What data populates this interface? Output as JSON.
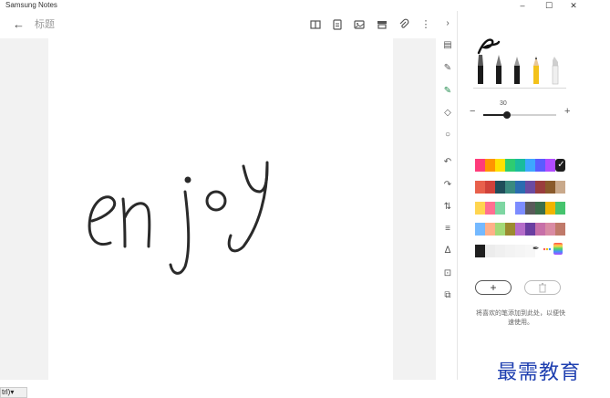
{
  "window": {
    "title": "Samsung Notes",
    "controls": [
      "minimize",
      "maximize",
      "close"
    ]
  },
  "toolbar": {
    "back_icon": "back-arrow-icon",
    "note_title": "标题",
    "icons": [
      "book-view-icon",
      "page-template-icon",
      "image-icon",
      "stamp-icon",
      "attach-icon",
      "more-icon"
    ]
  },
  "canvas": {
    "handwriting": "enjoy"
  },
  "side_tools": [
    "collapse-chevron-icon",
    "text-mode-icon",
    "pen-icon",
    "highlighter-icon",
    "eraser-icon",
    "lasso-icon",
    "undo-icon",
    "redo-icon",
    "spacing-icon",
    "format-icon",
    "ai-icon",
    "insert-icon",
    "layers-icon"
  ],
  "pen_panel": {
    "pens": [
      "brush-pen",
      "fountain-pen",
      "calligraphy-pen",
      "pencil",
      "marker"
    ],
    "size": {
      "label": "30",
      "min_icon": "−",
      "max_icon": "+",
      "value_fraction": 0.32
    },
    "palette": [
      [
        "#ff3b7a",
        "#ff9500",
        "#ffe100",
        "#2ecc71",
        "#1abc9c",
        "#3ea6ff",
        "#5a5cff",
        "#b14cff",
        "#1d1d1d"
      ],
      [
        "#e8604c",
        "#d0423a",
        "#1f4e5a",
        "#3a8a7f",
        "#2b6cb0",
        "#6b4ba1",
        "#9a3d3d",
        "#8a5a2b",
        "#c9a98b"
      ],
      [
        "#ffd54f",
        "#ff6f91",
        "#7ed6a2",
        "#ffffff",
        "#7c8cff",
        "#5a5a5a",
        "#3c6e4a",
        "#f0b400",
        "#46c46e"
      ],
      [
        "#74b9ff",
        "#ffb088",
        "#a3d977",
        "#9c8b2f",
        "#b56cc9",
        "#6a3ea1",
        "#c76fa8",
        "#d98ba4",
        "#c07a6a"
      ],
      [
        "#1f1f1f",
        "#ececec",
        "#f0f0f0",
        "#f3f3f3",
        "#f5f5f5",
        "#f7f7f7"
      ]
    ],
    "selected_color": "#1d1d1d",
    "check_mark": "✓",
    "eyedropper_icon": "eyedropper-icon",
    "palette_icon": "palette-icon",
    "spectrum_icon": "spectrum-icon",
    "add_label": "+",
    "delete_icon": "trash-icon",
    "hint": "将喜欢的笔添加到此处，以便快速使用。"
  },
  "taskbar": {
    "chip_label": "trl)▾"
  },
  "watermark": "最需教育"
}
